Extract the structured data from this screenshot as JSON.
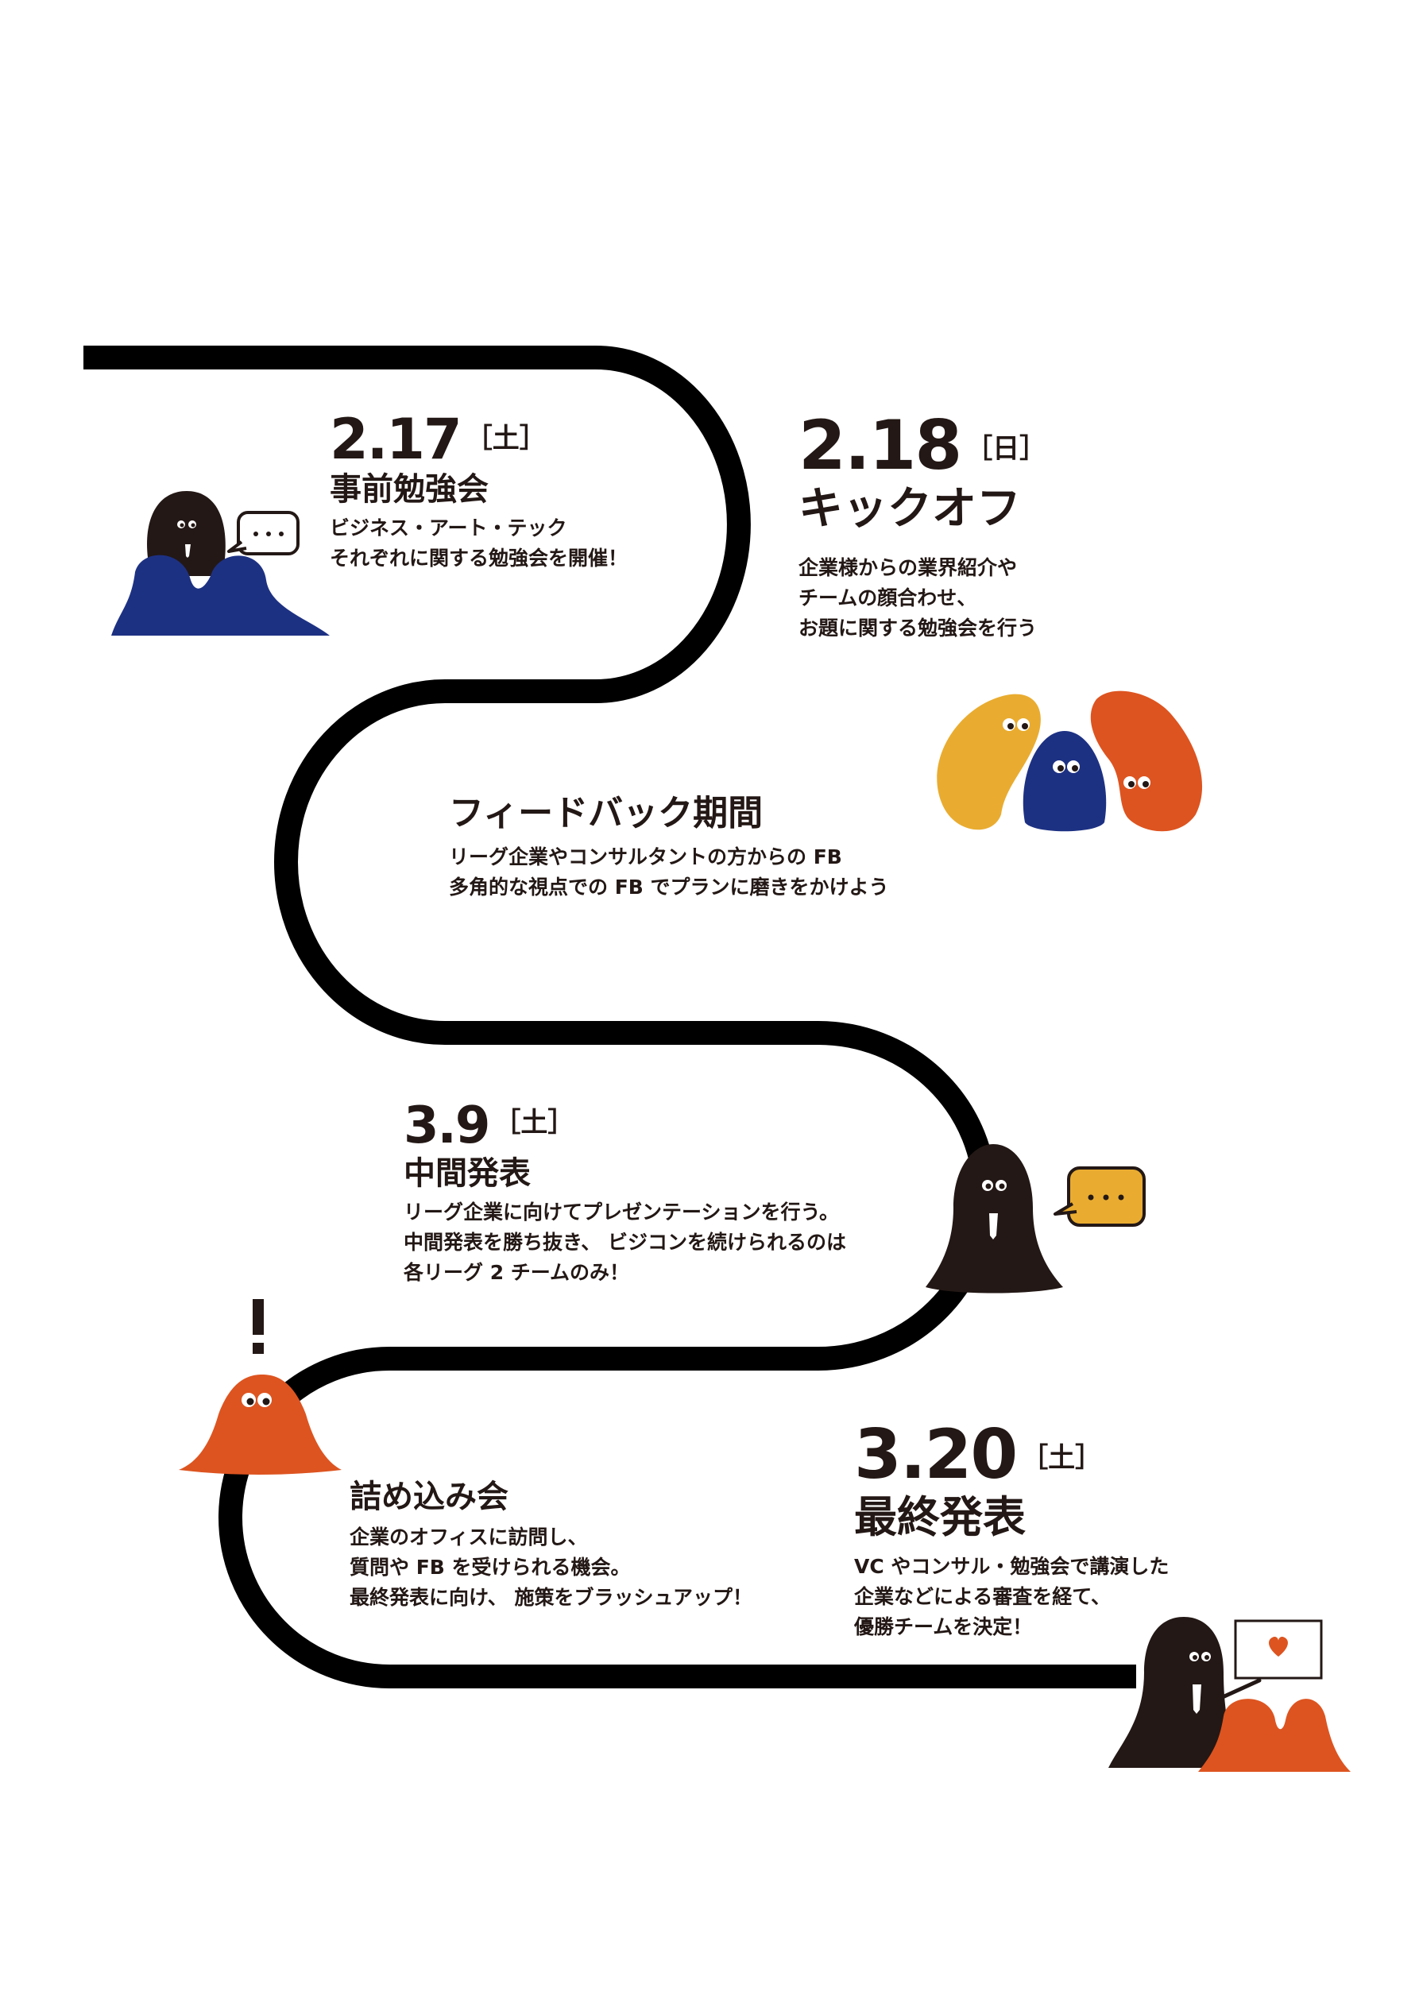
{
  "colors": {
    "path": "#000000",
    "ink": "#231815",
    "blue": "#1d3183",
    "orange": "#dd5420",
    "yellow": "#e9ac30"
  },
  "events": [
    {
      "date": "2.17",
      "day": "［土］",
      "title": "事前勉強会",
      "lines": [
        "ビジネス・アート・テック",
        "それぞれに関する勉強会を開催！"
      ]
    },
    {
      "date": "2.18",
      "day": "［日］",
      "title": "キックオフ",
      "lines": [
        "企業様からの業界紹介や",
        "チームの顔合わせ、",
        "お題に関する勉強会を行う"
      ]
    },
    {
      "title": "フィードバック期間",
      "lines": [
        "リーグ企業やコンサルタントの方からの FB",
        "多角的な視点での FB でプランに磨きをかけよう"
      ]
    },
    {
      "date": "3.9",
      "day": "［土］",
      "title": "中間発表",
      "lines": [
        "リーグ企業に向けてプレゼンテーションを行う。",
        "中間発表を勝ち抜き、 ビジコンを続けられるのは",
        "各リーグ 2 チームのみ！"
      ]
    },
    {
      "title": "詰め込み会",
      "lines": [
        "企業のオフィスに訪問し、",
        "質問や FB を受けられる機会。",
        "最終発表に向け、 施策をブラッシュアップ！"
      ]
    },
    {
      "date": "3.20",
      "day": "［土］",
      "title": "最終発表",
      "lines": [
        "VC やコンサル・勉強会で講演した",
        "企業などによる審査を経て、",
        "優勝チームを決定！"
      ]
    }
  ],
  "illustrations": {
    "speech_dots": "...",
    "exclaim": "!",
    "characters": [
      "teacher-blob",
      "audience-blobs",
      "trio-blobs",
      "presenter-blob",
      "surprised-blob",
      "final-presenter-blob"
    ],
    "icons": [
      "speech-bubble-icon",
      "heart-icon",
      "necktie-icon"
    ]
  }
}
